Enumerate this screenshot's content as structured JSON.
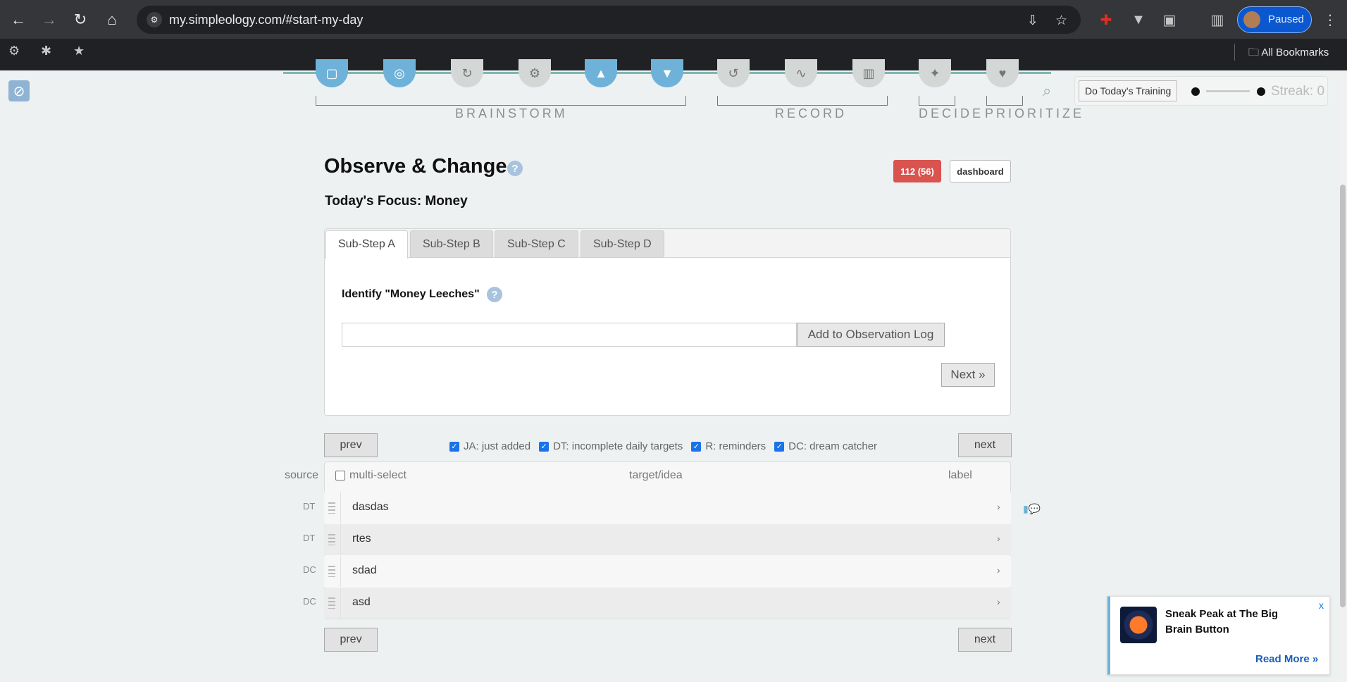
{
  "browser": {
    "url": "my.simpleology.com/#start-my-day",
    "profile_label": "Paused",
    "bookmarks_label": "All Bookmarks"
  },
  "stages": {
    "brainstorm": "BRAINSTORM",
    "record": "RECORD",
    "decide": "DECIDE",
    "prioritize": "PRIORITIZE"
  },
  "training": {
    "button_label": "Do Today's Training",
    "streak_label": "Streak: 0"
  },
  "header": {
    "title": "Observe & Change",
    "help": "?",
    "badge": "112 (56)",
    "dashboard_label": "dashboard",
    "focus": "Today's Focus: Money"
  },
  "tabs": [
    {
      "label": "Sub-Step A"
    },
    {
      "label": "Sub-Step B"
    },
    {
      "label": "Sub-Step C"
    },
    {
      "label": "Sub-Step D"
    }
  ],
  "step": {
    "heading": "Identify \"Money Leeches\"",
    "input_value": "",
    "input_placeholder": "",
    "add_button": "Add to Observation Log",
    "next_button": "Next »"
  },
  "pager": {
    "prev": "prev",
    "next": "next"
  },
  "filters": [
    {
      "label": "JA: just added",
      "checked": true
    },
    {
      "label": "DT: incomplete daily targets",
      "checked": true
    },
    {
      "label": "R: reminders",
      "checked": true
    },
    {
      "label": "DC: dream catcher",
      "checked": true
    }
  ],
  "table": {
    "col_source": "source",
    "col_multiselect": "multi-select",
    "col_target": "target/idea",
    "col_label": "label",
    "rows": [
      {
        "source": "DT",
        "text": "dasdas"
      },
      {
        "source": "DT",
        "text": "rtes"
      },
      {
        "source": "DC",
        "text": "sdad"
      },
      {
        "source": "DC",
        "text": "asd"
      }
    ]
  },
  "promo": {
    "title": "Sneak Peak at The Big Brain Button",
    "close": "x",
    "read_more": "Read More »"
  },
  "colors": {
    "accent_blue": "#6fb2d9",
    "badge_red": "#d9534f",
    "chrome_dark": "#35363a"
  }
}
